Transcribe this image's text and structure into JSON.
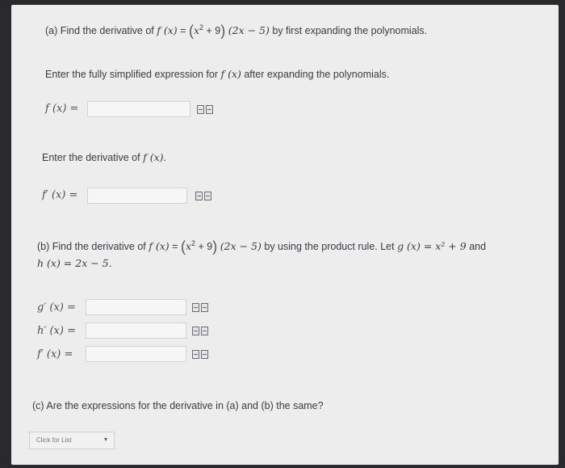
{
  "part_a": {
    "prefix": "(a) Find the derivative of",
    "suffix": "by first expanding the polynomials.",
    "expand_instruction": "Enter the fully simplified expression for",
    "expand_suffix": "after expanding the polynomials.",
    "f_label": "f (x) =",
    "f_value": "",
    "derivative_instruction": "Enter the derivative of",
    "fprime_label": "f′ (x) =",
    "fprime_value": ""
  },
  "part_b": {
    "prefix": "(b) Find the derivative of",
    "suffix": "by using the product rule. Let",
    "g_def": "g (x) = x² + 9",
    "and": "and",
    "h_def": "h (x) = 2x − 5.",
    "gprime_label": "g′ (x) =",
    "hprime_label": "h′ (x) =",
    "fprime_label": "f′ (x) =",
    "gprime_value": "",
    "hprime_value": "",
    "fprime_value": ""
  },
  "part_c": {
    "question": "(c) Are the expressions for the derivative in (a) and (b) the same?",
    "select_text": "Click for List"
  },
  "math": {
    "f_of_x": "f (x)",
    "equals": "=",
    "x": "x",
    "exp": "2",
    "plus9": "+ 9",
    "linear": "(2x − 5)",
    "open_paren": "(",
    "close_paren": ")",
    "period": "."
  }
}
